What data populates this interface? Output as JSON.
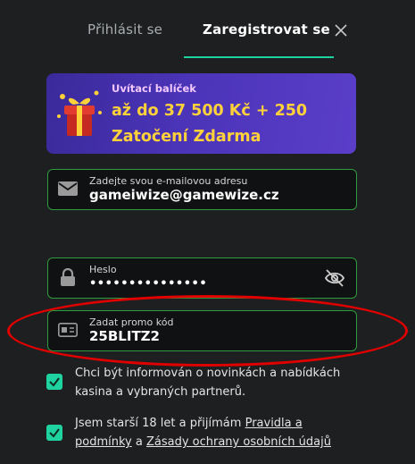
{
  "tabs": {
    "login": "Přihlásit se",
    "register": "Zaregistrovat se"
  },
  "icons": {
    "close": "close-icon",
    "gift": "gift-icon",
    "email": "envelope-icon",
    "password": "lock-icon",
    "password_toggle": "eye-off-icon",
    "promo": "card-icon",
    "checkbox": "checkmark-icon"
  },
  "banner": {
    "subtitle": "Uvítací balíček",
    "line1": "až do 37 500 Kč + 250",
    "line2": "Zatočení Zdarma"
  },
  "email": {
    "label": "Zadejte svou e-mailovou adresu",
    "value": "gameiwize@gamewize.cz"
  },
  "password": {
    "label": "Heslo",
    "value": "•••••••••••••••"
  },
  "promo": {
    "label": "Zadat promo kód",
    "value": "25BLITZ2"
  },
  "consents": {
    "newsletter": "Chci být informován o novinkách a nabídkách kasina a vybraných partnerů.",
    "terms_prefix": "Jsem starší 18 let a přijímám ",
    "terms_link": "Pravidla a podmínky",
    "terms_and": " a ",
    "privacy_link": "Zásady ochrany osobních údajů"
  },
  "colors": {
    "accent": "#1fd3a0",
    "field_border": "#2f9a3e",
    "banner_text": "#ffd23a",
    "annotation": "#e00000"
  }
}
